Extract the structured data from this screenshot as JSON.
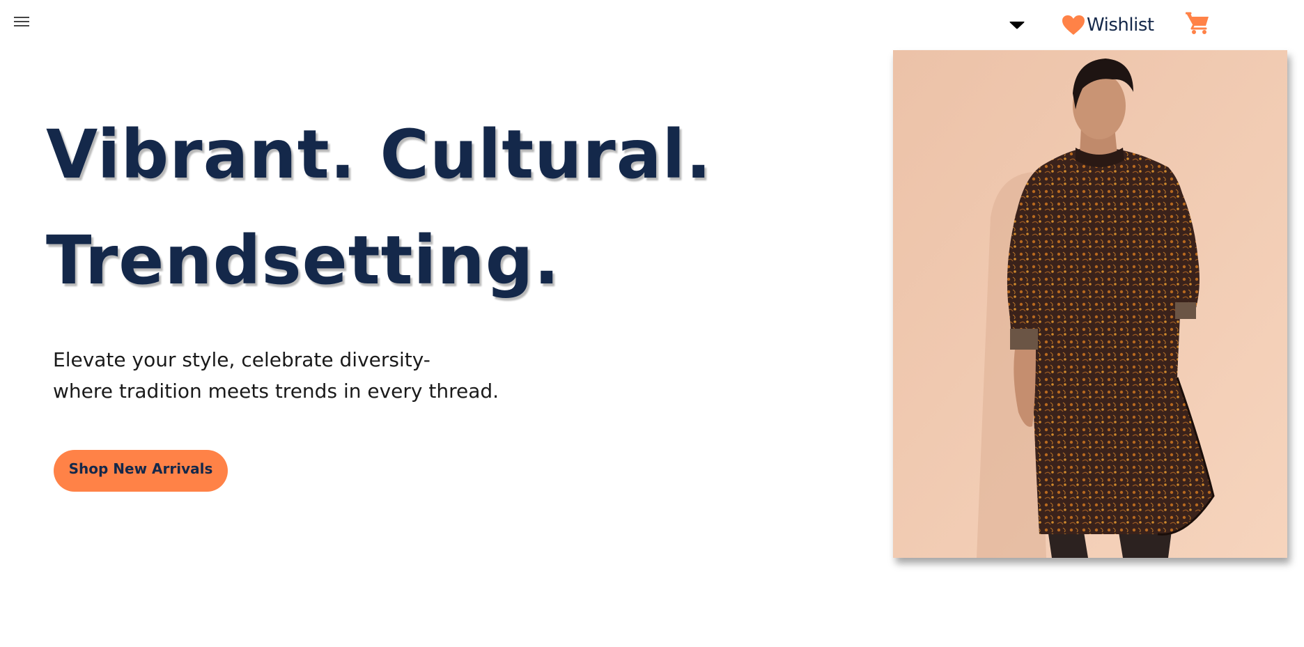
{
  "header": {
    "menu_icon": "hamburger-menu-icon",
    "dropdown_icon": "caret-down-icon",
    "wishlist_label": "Wishlist",
    "wishlist_icon": "heart-icon",
    "cart_icon": "shopping-cart-icon"
  },
  "hero": {
    "title_line1": "Vibrant. Cultural.",
    "title_line2": "Trendsetting.",
    "subtitle_line1": "Elevate your style, celebrate diversity-",
    "subtitle_line2": "where tradition meets trends in every thread.",
    "cta_label": "Shop New Arrivals"
  },
  "colors": {
    "accent": "#ff8247",
    "heading": "#14284a",
    "heart": "#ff8247",
    "cart": "#ff8247",
    "photo_background": "#f1c9ae"
  }
}
